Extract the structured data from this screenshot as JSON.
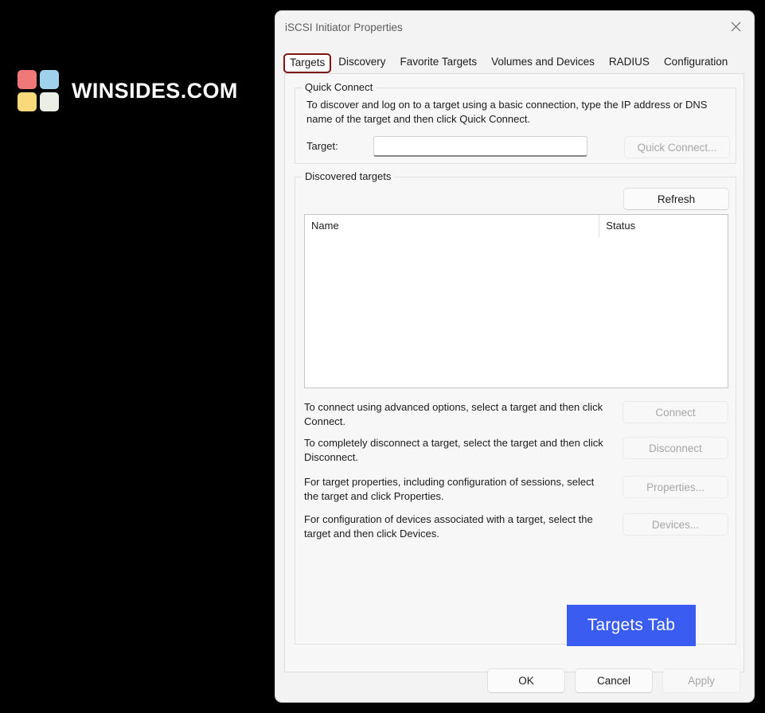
{
  "brand": {
    "name": "WINSIDES.COM",
    "logo_colors": {
      "top_left": "#f07878",
      "top_right": "#9fd0ec",
      "bottom_left": "#fad97b",
      "bottom_right": "#ebeee4"
    }
  },
  "window": {
    "title": "iSCSI Initiator Properties",
    "close_icon": "close-icon"
  },
  "tabs": [
    {
      "label": "Targets",
      "selected": true
    },
    {
      "label": "Discovery",
      "selected": false
    },
    {
      "label": "Favorite Targets",
      "selected": false
    },
    {
      "label": "Volumes and Devices",
      "selected": false
    },
    {
      "label": "RADIUS",
      "selected": false
    },
    {
      "label": "Configuration",
      "selected": false
    }
  ],
  "quick_connect": {
    "legend": "Quick Connect",
    "description": "To discover and log on to a target using a basic connection, type the IP address or DNS name of the target and then click Quick Connect.",
    "target_label": "Target:",
    "target_value": "",
    "target_placeholder": "",
    "button_label": "Quick Connect...",
    "button_disabled": true
  },
  "discovered_targets": {
    "legend": "Discovered targets",
    "refresh_label": "Refresh",
    "refresh_disabled": false,
    "columns": [
      "Name",
      "Status"
    ],
    "rows": [],
    "actions": [
      {
        "description": "To connect using advanced options, select a target and then click Connect.",
        "button_label": "Connect",
        "button_disabled": true
      },
      {
        "description": "To completely disconnect a target, select the target and then click Disconnect.",
        "button_label": "Disconnect",
        "button_disabled": true
      },
      {
        "description": "For target properties, including configuration of sessions, select the target and click Properties.",
        "button_label": "Properties...",
        "button_disabled": true
      },
      {
        "description": "For configuration of devices associated with a target, select the target and then click Devices.",
        "button_label": "Devices...",
        "button_disabled": true
      }
    ]
  },
  "callout": {
    "label": "Targets Tab",
    "background": "#3b5cf0",
    "text_color": "#ffffff"
  },
  "footer": {
    "ok_label": "OK",
    "cancel_label": "Cancel",
    "apply_label": "Apply",
    "apply_disabled": true
  }
}
